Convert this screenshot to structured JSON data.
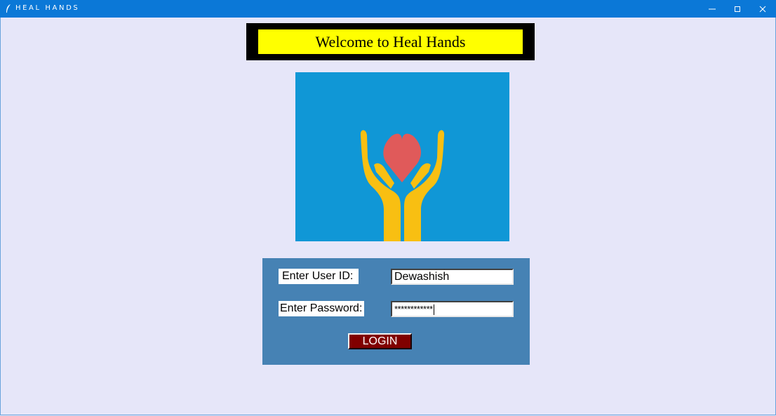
{
  "window": {
    "title": "HEAL HANDS",
    "controls": [
      "minimize-icon",
      "maximize-icon",
      "close-icon"
    ],
    "titlebar_color": "#0b78d7"
  },
  "banner": {
    "title": "Welcome to Heal Hands",
    "background": "#ffff00",
    "frame_color": "#000000"
  },
  "logo": {
    "icon": "heart-in-hands-icon",
    "background": "#1097d6",
    "heart_color": "#e05a5a",
    "hands_color": "#f8bf12"
  },
  "login": {
    "panel_color": "#4682b4",
    "user_label": "Enter User ID:",
    "user_value": "Dewashish",
    "password_label": "Enter Password:",
    "password_value": "************",
    "button_label": "LOGIN",
    "button_color": "#800000"
  }
}
